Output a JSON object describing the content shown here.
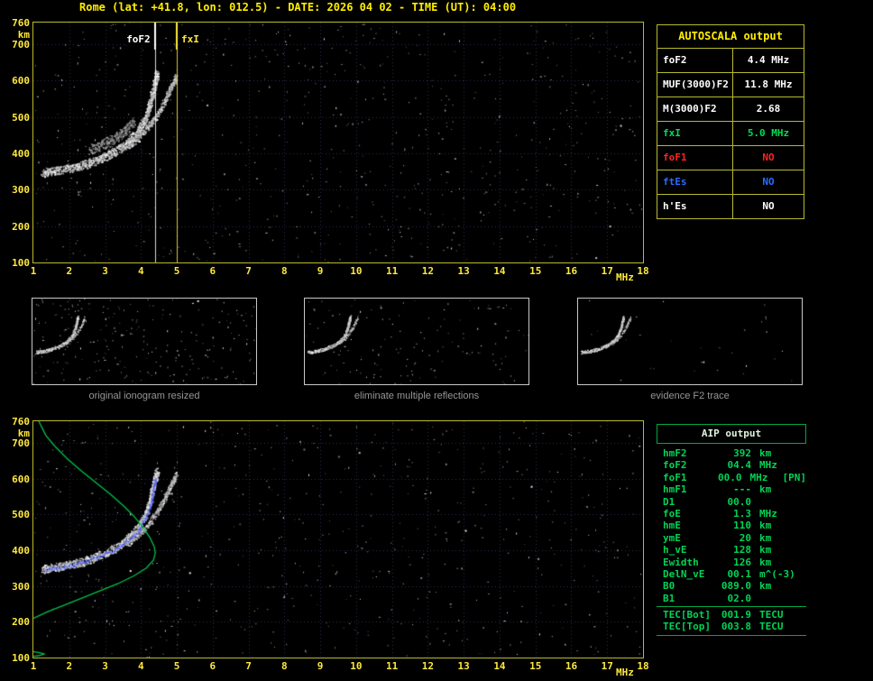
{
  "header": {
    "title": "Rome (lat: +41.8, lon: 012.5) - DATE: 2026 04 02 - TIME (UT): 04:00"
  },
  "colors": {
    "background": "#000000",
    "axis_yellow": "#ffe93c",
    "title_yellow": "#ffee00",
    "plot_border": "#b9b92e",
    "grid": "#2f2f52",
    "autoscala_green": "#00dd55",
    "alert_red": "#ff2222",
    "es_blue": "#2b6bff",
    "aip_green": "#00d455",
    "profile_green": "#00c24a",
    "restored_blue": "#4a5cff",
    "caption_gray": "#969696"
  },
  "autoscala": {
    "title": "AUTOSCALA output",
    "rows": [
      {
        "label": "foF2",
        "value": "4.4 MHz",
        "color": "#ffffff"
      },
      {
        "label": "MUF(3000)F2",
        "value": "11.8 MHz",
        "color": "#ffffff"
      },
      {
        "label": "M(3000)F2",
        "value": "2.68",
        "color": "#ffffff"
      },
      {
        "label": "fxI",
        "value": "5.0 MHz",
        "color": "#00dd55"
      },
      {
        "label": "foF1",
        "value": "NO",
        "color": "#ff2222"
      },
      {
        "label": "ftEs",
        "value": "NO",
        "color": "#2b6bff"
      },
      {
        "label": "h'Es",
        "value": "NO",
        "color": "#ffffff"
      }
    ]
  },
  "aip": {
    "title": "AIP output",
    "rows": [
      {
        "name": "hmF2",
        "value": "392",
        "unit": "km",
        "extra": ""
      },
      {
        "name": "foF2",
        "value": "04.4",
        "unit": "MHz",
        "extra": ""
      },
      {
        "name": "foF1",
        "value": "00.0",
        "unit": "MHz",
        "extra": "[PN]"
      },
      {
        "name": "hmF1",
        "value": "---",
        "unit": "km",
        "extra": ""
      },
      {
        "name": "D1",
        "value": "00.0",
        "unit": "",
        "extra": ""
      },
      {
        "name": "foE",
        "value": "1.3",
        "unit": "MHz",
        "extra": ""
      },
      {
        "name": "hmE",
        "value": "110",
        "unit": "km",
        "extra": ""
      },
      {
        "name": "ymE",
        "value": "20",
        "unit": "km",
        "extra": ""
      },
      {
        "name": "h_vE",
        "value": "128",
        "unit": "km",
        "extra": ""
      },
      {
        "name": "Ewidth",
        "value": "126",
        "unit": "km",
        "extra": ""
      },
      {
        "name": "DelN_vE",
        "value": "00.1",
        "unit": "m^(-3)",
        "extra": ""
      },
      {
        "name": "B0",
        "value": "089.0",
        "unit": "km",
        "extra": ""
      },
      {
        "name": "B1",
        "value": "02.0",
        "unit": "",
        "extra": ""
      }
    ],
    "tec_rows": [
      {
        "name": "TEC[Bot]",
        "value": "001.9",
        "unit": "TECU",
        "extra": ""
      },
      {
        "name": "TEC[Top]",
        "value": "003.8",
        "unit": "TECU",
        "extra": ""
      }
    ]
  },
  "thumbnails": [
    {
      "caption": "original ionogram resized"
    },
    {
      "caption": "eliminate multiple reflections"
    },
    {
      "caption": "evidence F2 trace"
    }
  ],
  "chart_data": [
    {
      "type": "scatter",
      "name": "main-ionogram",
      "title": "",
      "xlabel": "MHz",
      "ylabel": "km",
      "xlim": [
        1,
        18
      ],
      "ylim": [
        100,
        760
      ],
      "grid": true,
      "x_ticks": [
        1,
        2,
        3,
        4,
        5,
        6,
        7,
        8,
        9,
        10,
        11,
        12,
        13,
        14,
        15,
        16,
        17,
        18
      ],
      "y_ticks": [
        100,
        200,
        300,
        400,
        500,
        600,
        700,
        760
      ],
      "markers": [
        {
          "label": "foF2",
          "freq": 4.4,
          "color": "#ffffff"
        },
        {
          "label": "fxI",
          "freq": 5.0,
          "color": "#ffe93c"
        }
      ],
      "series": [
        {
          "name": "F2-trace-o-mode",
          "points": [
            [
              1.25,
              348
            ],
            [
              1.5,
              352
            ],
            [
              1.8,
              356
            ],
            [
              2.1,
              362
            ],
            [
              2.4,
              370
            ],
            [
              2.7,
              380
            ],
            [
              3.0,
              393
            ],
            [
              3.3,
              408
            ],
            [
              3.55,
              425
            ],
            [
              3.75,
              444
            ],
            [
              3.95,
              468
            ],
            [
              4.1,
              495
            ],
            [
              4.2,
              522
            ],
            [
              4.28,
              550
            ],
            [
              4.34,
              578
            ],
            [
              4.4,
              605
            ],
            [
              4.44,
              620
            ]
          ]
        },
        {
          "name": "F2-trace-x-mode",
          "points": [
            [
              3.6,
              418
            ],
            [
              3.9,
              442
            ],
            [
              4.15,
              468
            ],
            [
              4.4,
              500
            ],
            [
              4.6,
              535
            ],
            [
              4.75,
              565
            ],
            [
              4.88,
              592
            ],
            [
              4.97,
              612
            ]
          ]
        },
        {
          "name": "spread-echoes",
          "points": [
            [
              2.55,
              412
            ],
            [
              2.9,
              424
            ],
            [
              3.25,
              442
            ],
            [
              3.55,
              462
            ],
            [
              3.8,
              486
            ]
          ]
        }
      ]
    },
    {
      "type": "scatter",
      "name": "ionogram-with-profile",
      "title": "",
      "xlabel": "MHz",
      "ylabel": "km",
      "xlim": [
        1,
        18
      ],
      "ylim": [
        100,
        760
      ],
      "grid": true,
      "x_ticks": [
        1,
        2,
        3,
        4,
        5,
        6,
        7,
        8,
        9,
        10,
        11,
        12,
        13,
        14,
        15,
        16,
        17,
        18
      ],
      "y_ticks": [
        100,
        200,
        300,
        400,
        500,
        600,
        700,
        760
      ],
      "series": [
        {
          "name": "F2-trace-o-mode",
          "points": [
            [
              1.25,
              348
            ],
            [
              1.5,
              352
            ],
            [
              1.8,
              356
            ],
            [
              2.1,
              362
            ],
            [
              2.4,
              370
            ],
            [
              2.7,
              380
            ],
            [
              3.0,
              393
            ],
            [
              3.3,
              408
            ],
            [
              3.55,
              425
            ],
            [
              3.75,
              444
            ],
            [
              3.95,
              468
            ],
            [
              4.1,
              495
            ],
            [
              4.2,
              522
            ],
            [
              4.28,
              550
            ],
            [
              4.34,
              578
            ],
            [
              4.4,
              605
            ],
            [
              4.44,
              620
            ]
          ]
        },
        {
          "name": "F2-trace-x-mode",
          "points": [
            [
              3.6,
              418
            ],
            [
              3.9,
              442
            ],
            [
              4.15,
              468
            ],
            [
              4.4,
              500
            ],
            [
              4.6,
              535
            ],
            [
              4.75,
              565
            ],
            [
              4.88,
              592
            ],
            [
              4.97,
              612
            ]
          ]
        }
      ],
      "restored_trace": {
        "name": "autoscala-restored-trace",
        "color": "#4a5cff",
        "points": [
          [
            1.35,
            346
          ],
          [
            1.7,
            352
          ],
          [
            2.1,
            360
          ],
          [
            2.5,
            372
          ],
          [
            2.9,
            386
          ],
          [
            3.3,
            404
          ],
          [
            3.65,
            428
          ],
          [
            3.95,
            458
          ],
          [
            4.15,
            495
          ],
          [
            4.28,
            535
          ],
          [
            4.35,
            572
          ],
          [
            4.4,
            600
          ]
        ]
      },
      "profile": {
        "name": "electron-density-profile",
        "color": "#00c24a",
        "points": [
          [
            1.15,
            760
          ],
          [
            1.35,
            720
          ],
          [
            1.6,
            690
          ],
          [
            1.95,
            655
          ],
          [
            2.35,
            620
          ],
          [
            2.75,
            588
          ],
          [
            3.15,
            556
          ],
          [
            3.5,
            525
          ],
          [
            3.8,
            495
          ],
          [
            4.05,
            465
          ],
          [
            4.25,
            435
          ],
          [
            4.37,
            410
          ],
          [
            4.4,
            392
          ],
          [
            4.35,
            372
          ],
          [
            4.15,
            350
          ],
          [
            3.8,
            328
          ],
          [
            3.35,
            306
          ],
          [
            2.85,
            286
          ],
          [
            2.35,
            266
          ],
          [
            1.85,
            246
          ],
          [
            1.4,
            228
          ],
          [
            1.05,
            212
          ],
          [
            0.75,
            196
          ],
          [
            0.5,
            180
          ],
          [
            0.33,
            163
          ],
          [
            0.25,
            148
          ],
          [
            0.22,
            136
          ],
          [
            0.3,
            128
          ],
          [
            0.8,
            120
          ],
          [
            1.2,
            113
          ],
          [
            1.3,
            110
          ],
          [
            1.15,
            105
          ],
          [
            0.7,
            101
          ],
          [
            0.4,
            100
          ]
        ]
      }
    }
  ]
}
